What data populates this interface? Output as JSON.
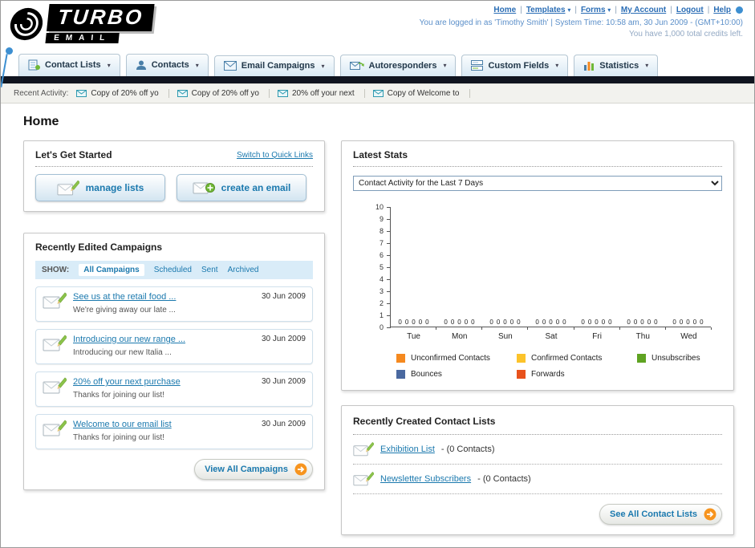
{
  "header": {
    "logo_line1": "TURBO",
    "logo_line2": "EMAIL",
    "links": [
      {
        "label": "Home"
      },
      {
        "label": "Templates"
      },
      {
        "label": "Forms"
      },
      {
        "label": "My Account"
      },
      {
        "label": "Logout"
      },
      {
        "label": "Help"
      }
    ],
    "login_info": "You are logged in as 'Timothy Smith' | System Time: 10:58 am, 30 Jun 2009 - (GMT+10:00)",
    "credits_info": "You have 1,000 total credits left."
  },
  "nav": {
    "tabs": [
      {
        "label": "Contact Lists"
      },
      {
        "label": "Contacts"
      },
      {
        "label": "Email Campaigns"
      },
      {
        "label": "Autoresponders"
      },
      {
        "label": "Custom Fields"
      },
      {
        "label": "Statistics"
      }
    ]
  },
  "activity": {
    "label": "Recent Activity:",
    "items": [
      {
        "label": "Copy of 20% off yo"
      },
      {
        "label": "Copy of 20% off yo"
      },
      {
        "label": "20% off your next"
      },
      {
        "label": "Copy of Welcome to"
      }
    ]
  },
  "page": {
    "title": "Home"
  },
  "get_started": {
    "title": "Let's Get Started",
    "switch_link": "Switch to Quick Links",
    "manage_lists_label": "manage lists",
    "create_email_label": "create an email"
  },
  "campaigns": {
    "title": "Recently Edited Campaigns",
    "show_label": "SHOW:",
    "filters": [
      {
        "label": "All Campaigns",
        "active": true
      },
      {
        "label": "Scheduled",
        "active": false
      },
      {
        "label": "Sent",
        "active": false
      },
      {
        "label": "Archived",
        "active": false
      }
    ],
    "items": [
      {
        "title": "See us at the retail food ...",
        "subtitle": "We're giving away our late ...",
        "date": "30 Jun 2009"
      },
      {
        "title": "Introducing our new range ...",
        "subtitle": "Introducing our new Italia ...",
        "date": "30 Jun 2009"
      },
      {
        "title": "20% off your next purchase",
        "subtitle": "Thanks for joining our list!",
        "date": "30 Jun 2009"
      },
      {
        "title": "Welcome to our email list",
        "subtitle": "Thanks for joining our list!",
        "date": "30 Jun 2009"
      }
    ],
    "view_all_label": "View All Campaigns"
  },
  "stats": {
    "title": "Latest Stats",
    "dropdown_value": "Contact Activity for the Last 7 Days",
    "chart_data": {
      "type": "bar",
      "title": "Contact Activity for the Last 7 Days",
      "categories": [
        "Tue",
        "Mon",
        "Sun",
        "Sat",
        "Fri",
        "Thu",
        "Wed"
      ],
      "series": [
        {
          "name": "Unconfirmed Contacts",
          "color": "#f5891f",
          "values": [
            0,
            0,
            0,
            0,
            0,
            0,
            0
          ]
        },
        {
          "name": "Confirmed Contacts",
          "color": "#fcc32a",
          "values": [
            0,
            0,
            0,
            0,
            0,
            0,
            0
          ]
        },
        {
          "name": "Unsubscribes",
          "color": "#5fa322",
          "values": [
            0,
            0,
            0,
            0,
            0,
            0,
            0
          ]
        },
        {
          "name": "Bounces",
          "color": "#4a69a0",
          "values": [
            0,
            0,
            0,
            0,
            0,
            0,
            0
          ]
        },
        {
          "name": "Forwards",
          "color": "#e8521c",
          "values": [
            0,
            0,
            0,
            0,
            0,
            0,
            0
          ]
        }
      ],
      "ylim": [
        0,
        10
      ],
      "yticks": [
        0,
        1,
        2,
        3,
        4,
        5,
        6,
        7,
        8,
        9,
        10
      ],
      "grid": false,
      "legend_position": "bottom"
    }
  },
  "contact_lists": {
    "title": "Recently Created Contact Lists",
    "items": [
      {
        "name": "Exhibition List",
        "detail": "- (0 Contacts)"
      },
      {
        "name": "Newsletter Subscribers",
        "detail": "- (0 Contacts)"
      }
    ],
    "see_all_label": "See All Contact Lists"
  },
  "colors": {
    "link_blue": "#1b79ae",
    "dark_bar": "#10141f",
    "accent_orange": "#f7941e"
  }
}
